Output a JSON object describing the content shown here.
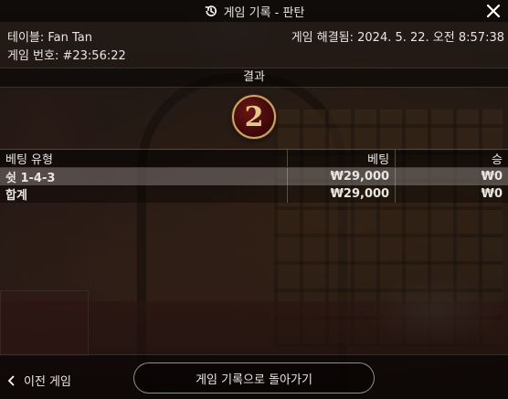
{
  "header": {
    "title": "게임 기록 - 판탄"
  },
  "info": {
    "table_label": "테이블: Fan Tan",
    "resolved_label": "게임 해결됨: 2024. 5. 22. 오전 8:57:38",
    "game_number_label": "게임 번호: #23:56:22"
  },
  "result": {
    "label": "결과",
    "value": "2"
  },
  "bets_table": {
    "headers": [
      "베팅 유형",
      "베팅",
      "승"
    ],
    "rows": [
      {
        "type": "쉿 1-4-3",
        "bet": "₩29,000",
        "win": "₩0"
      }
    ],
    "total": {
      "label": "합계",
      "bet": "₩29,000",
      "win": "₩0"
    }
  },
  "footer": {
    "prev_label": "이전 게임",
    "back_label": "게임 기록으로 돌아가기"
  },
  "colors": {
    "accent_gold": "#e6c88b",
    "ball_red": "#6b1616"
  },
  "icons": [
    "history-icon",
    "close-icon",
    "chevron-left-icon"
  ]
}
